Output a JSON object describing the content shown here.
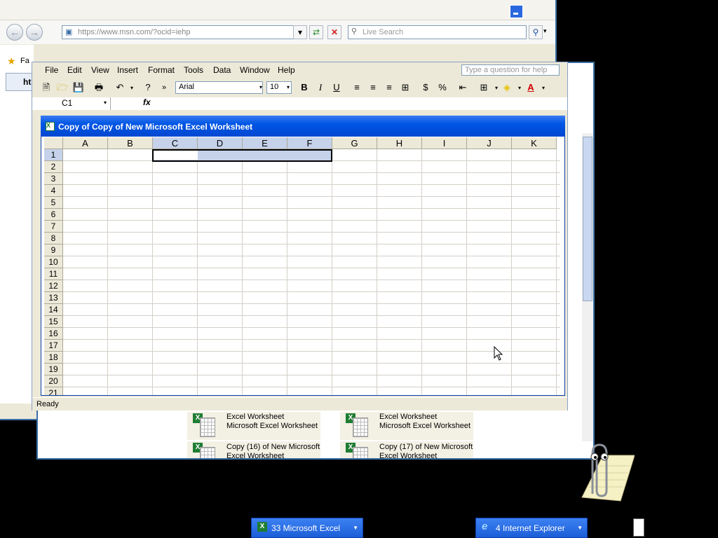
{
  "ie": {
    "address": "https://www.msn.com/?ocid=iehp",
    "search_placeholder": "Live Search",
    "favorites_label": "Fa",
    "tab_stub": "ht"
  },
  "explorer_files": [
    {
      "line1": "Excel Worksheet",
      "line2": "Microsoft Excel Worksheet"
    },
    {
      "line1": "Excel Worksheet",
      "line2": "Microsoft Excel Worksheet"
    },
    {
      "line1": "Copy (16) of New Microsoft",
      "line2": "Excel Worksheet"
    },
    {
      "line1": "Copy (17) of New Microsoft",
      "line2": "Excel Worksheet"
    }
  ],
  "excel": {
    "menu": [
      "File",
      "Edit",
      "View",
      "Insert",
      "Format",
      "Tools",
      "Data",
      "Window",
      "Help"
    ],
    "help_placeholder": "Type a question for help",
    "font": "Arial",
    "font_size": "10",
    "name_box": "C1",
    "fx": "fx",
    "workbook_title": "Copy of Copy of New Microsoft Excel Worksheet",
    "columns": [
      "A",
      "B",
      "C",
      "D",
      "E",
      "F",
      "G",
      "H",
      "I",
      "J",
      "K"
    ],
    "rows": [
      "1",
      "2",
      "3",
      "4",
      "5",
      "6",
      "7",
      "8",
      "9",
      "10",
      "11",
      "12",
      "13",
      "14",
      "15",
      "16",
      "17",
      "18",
      "19",
      "20",
      "21"
    ],
    "selection": "C1:F1",
    "status": "Ready"
  },
  "taskbar": {
    "excel_group": "33 Microsoft Excel",
    "ie_group": "4 Internet Explorer"
  },
  "colors": {
    "titlebar": "#0055e5",
    "selection": "#c5d2ea",
    "chrome": "#ece9d8"
  }
}
